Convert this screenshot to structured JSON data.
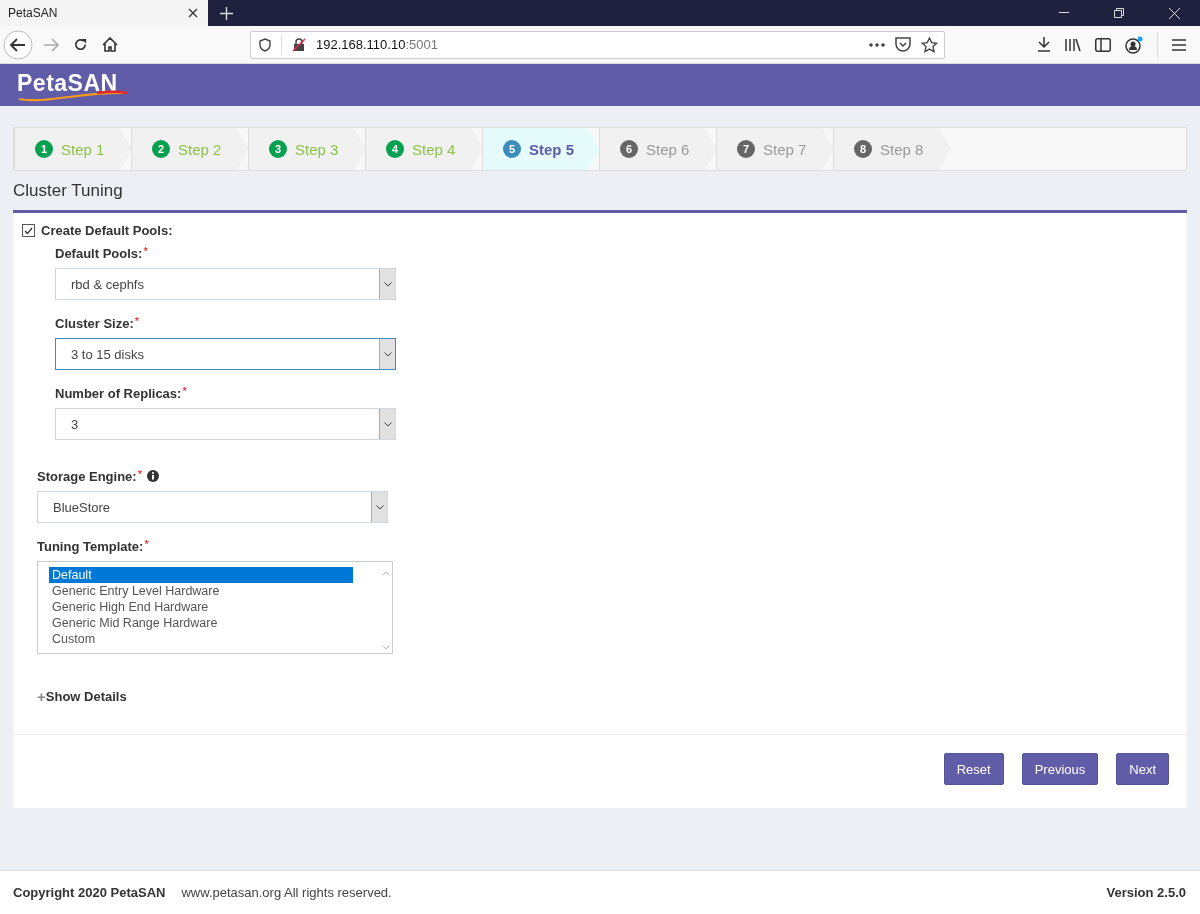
{
  "browser": {
    "tab_title": "PetaSAN",
    "url_host": "192.168.110.10",
    "url_port": ":5001"
  },
  "logo": "PetaSAN",
  "steps": [
    {
      "number": "1",
      "label": "Step 1",
      "done": true,
      "selected": false
    },
    {
      "number": "2",
      "label": "Step 2",
      "done": true,
      "selected": false
    },
    {
      "number": "3",
      "label": "Step 3",
      "done": true,
      "selected": false
    },
    {
      "number": "4",
      "label": "Step 4",
      "done": true,
      "selected": false
    },
    {
      "number": "5",
      "label": "Step 5",
      "done": false,
      "selected": true
    },
    {
      "number": "6",
      "label": "Step 6",
      "done": false,
      "selected": false
    },
    {
      "number": "7",
      "label": "Step 7",
      "done": false,
      "selected": false
    },
    {
      "number": "8",
      "label": "Step 8",
      "done": false,
      "selected": false
    }
  ],
  "page_title": "Cluster Tuning",
  "create_pools": {
    "label": "Create Default Pools:",
    "checked": true
  },
  "pool_fields": [
    {
      "label": "Default Pools:",
      "required_mark": "*",
      "value": "rbd & cephfs",
      "focused": false
    },
    {
      "label": "Cluster Size:",
      "required_mark": "*",
      "value": "3 to 15 disks",
      "focused": true
    },
    {
      "label": "Number of Replicas:",
      "required_mark": "*",
      "value": "3",
      "focused": false
    }
  ],
  "storage_engine": {
    "label": "Storage Engine:",
    "required_mark": "*",
    "info": true,
    "value": "BlueStore",
    "focused": false
  },
  "tuning_template": {
    "label": "Tuning Template:",
    "required_mark": "*",
    "options": [
      {
        "label": "Default",
        "selected": true
      },
      {
        "label": "Generic Entry Level Hardware",
        "selected": false
      },
      {
        "label": "Generic High End Hardware",
        "selected": false
      },
      {
        "label": "Generic Mid Range Hardware",
        "selected": false
      },
      {
        "label": "Custom",
        "selected": false
      }
    ]
  },
  "show_details": {
    "icon": "+",
    "label": "Show Details"
  },
  "buttons": [
    "Reset",
    "Previous",
    "Next"
  ],
  "footer": {
    "copyright": "Copyright 2020 PetaSAN",
    "site": "www.petasan.org All rights reserved.",
    "version": "Version 2.5.0"
  }
}
